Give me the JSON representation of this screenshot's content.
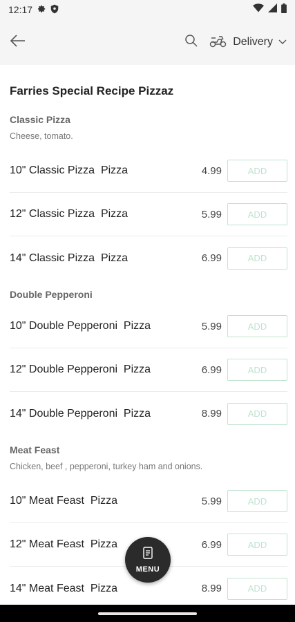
{
  "status_bar": {
    "time": "12:17",
    "icons_left": [
      "gear-icon",
      "shield-icon"
    ],
    "icons_right": [
      "wifi-icon",
      "signal-icon",
      "battery-icon"
    ]
  },
  "app_bar": {
    "back_icon": "arrow-left-icon",
    "search_icon": "search-icon",
    "delivery_icon": "delivery-scooter-icon",
    "delivery_label": "Delivery",
    "dropdown_icon": "chevron-down-icon"
  },
  "menu": {
    "title": "Farries Special Recipe Pizzaz",
    "add_label": "ADD",
    "sections": [
      {
        "title": "Classic Pizza",
        "description": "Cheese, tomato.",
        "items": [
          {
            "name": "10\" Classic Pizza  Pizza",
            "price": "4.99"
          },
          {
            "name": "12\" Classic Pizza  Pizza",
            "price": "5.99"
          },
          {
            "name": "14\" Classic Pizza  Pizza",
            "price": "6.99"
          }
        ]
      },
      {
        "title": "Double Pepperoni",
        "description": "",
        "items": [
          {
            "name": "10\" Double Pepperoni  Pizza",
            "price": "5.99"
          },
          {
            "name": "12\" Double Pepperoni  Pizza",
            "price": "6.99"
          },
          {
            "name": "14\" Double Pepperoni  Pizza",
            "price": "8.99"
          }
        ]
      },
      {
        "title": "Meat Feast",
        "description": "Chicken, beef , pepperoni, turkey ham and onions.",
        "items": [
          {
            "name": "10\" Meat Feast  Pizza",
            "price": "5.99"
          },
          {
            "name": "12\" Meat Feast  Pizza",
            "price": "6.99"
          },
          {
            "name": "14\" Meat Feast  Pizza",
            "price": "8.99"
          }
        ]
      }
    ]
  },
  "fab": {
    "icon": "menu-book-icon",
    "label": "MENU"
  },
  "colors": {
    "add_border": "#bfe3cf",
    "fab_bg": "#2b2b2b",
    "header_bg": "#f5f5f5"
  }
}
